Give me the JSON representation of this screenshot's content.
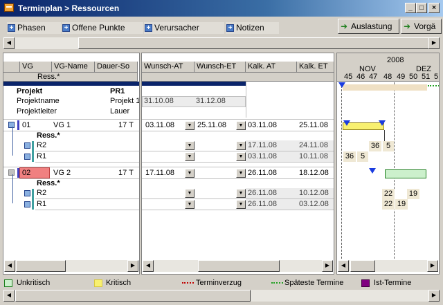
{
  "window": {
    "title": "Terminplan > Ressourcen"
  },
  "toolbar": {
    "tabs": [
      {
        "label": "Phasen"
      },
      {
        "label": "Offene Punkte"
      },
      {
        "label": "Verursacher"
      },
      {
        "label": "Notizen"
      }
    ],
    "right_buttons": [
      {
        "label": "Auslastung"
      },
      {
        "label": "Vorgä"
      }
    ]
  },
  "left_table": {
    "headers": {
      "vg": "VG",
      "vg_name": "VG-Name",
      "dauer": "Dauer-So",
      "ress": "Ress.*"
    },
    "project": {
      "heading_label": "Projekt",
      "heading_value": "PR1",
      "name_label": "Projektname",
      "name_value": "Projekt 1",
      "leader_label": "Projektleiter",
      "leader_value": "Lauer"
    },
    "rows": [
      {
        "vg": "01",
        "name": "VG 1",
        "dauer": "17 T",
        "ress_label": "Ress.*",
        "resources": [
          "R2",
          "R1"
        ]
      },
      {
        "vg": "02",
        "name": "VG 2",
        "dauer": "17 T",
        "ress_label": "Ress.*",
        "resources": [
          "R2",
          "R1"
        ]
      }
    ]
  },
  "mid_table": {
    "headers": {
      "wunsch_at": "Wunsch-AT",
      "wunsch_et": "Wunsch-ET",
      "kalk_at": "Kalk. AT",
      "kalk_et": "Kalk. ET"
    },
    "project": {
      "wunsch_at": "31.10.08",
      "wunsch_et": "31.12.08"
    },
    "rows": [
      {
        "wunsch_at": "03.11.08",
        "wunsch_et": "25.11.08",
        "kalk_at": "03.11.08",
        "kalk_et": "25.11.08",
        "res": [
          {
            "kalk_at": "17.11.08",
            "kalk_et": "24.11.08"
          },
          {
            "kalk_at": "03.11.08",
            "kalk_et": "10.11.08"
          }
        ]
      },
      {
        "wunsch_at": "17.11.08",
        "wunsch_et": "",
        "kalk_at": "26.11.08",
        "kalk_et": "18.12.08",
        "res": [
          {
            "kalk_at": "26.11.08",
            "kalk_et": "10.12.08"
          },
          {
            "kalk_at": "26.11.08",
            "kalk_et": "03.12.08"
          }
        ]
      }
    ]
  },
  "gantt": {
    "year": "2008",
    "months": [
      "NOV",
      "DEZ"
    ],
    "weeks": [
      "45",
      "46",
      "47",
      "48",
      "49",
      "50",
      "51",
      "5"
    ],
    "rows": [
      {
        "cells": [
          "36",
          "5"
        ]
      },
      {
        "cells": [
          "36",
          "5"
        ]
      },
      {
        "cells": [
          "22",
          "19"
        ]
      },
      {
        "cells": [
          "22",
          "19"
        ]
      }
    ]
  },
  "legend": [
    {
      "label": "Unkritisch",
      "color": "#ccf0cc"
    },
    {
      "label": "Kritisch",
      "color": "#f8f070"
    },
    {
      "label": "Terminverzug",
      "color": "#c00000"
    },
    {
      "label": "Späteste Termine",
      "color": "#20a020"
    },
    {
      "label": "Ist-Termine",
      "color": "#800080"
    }
  ]
}
